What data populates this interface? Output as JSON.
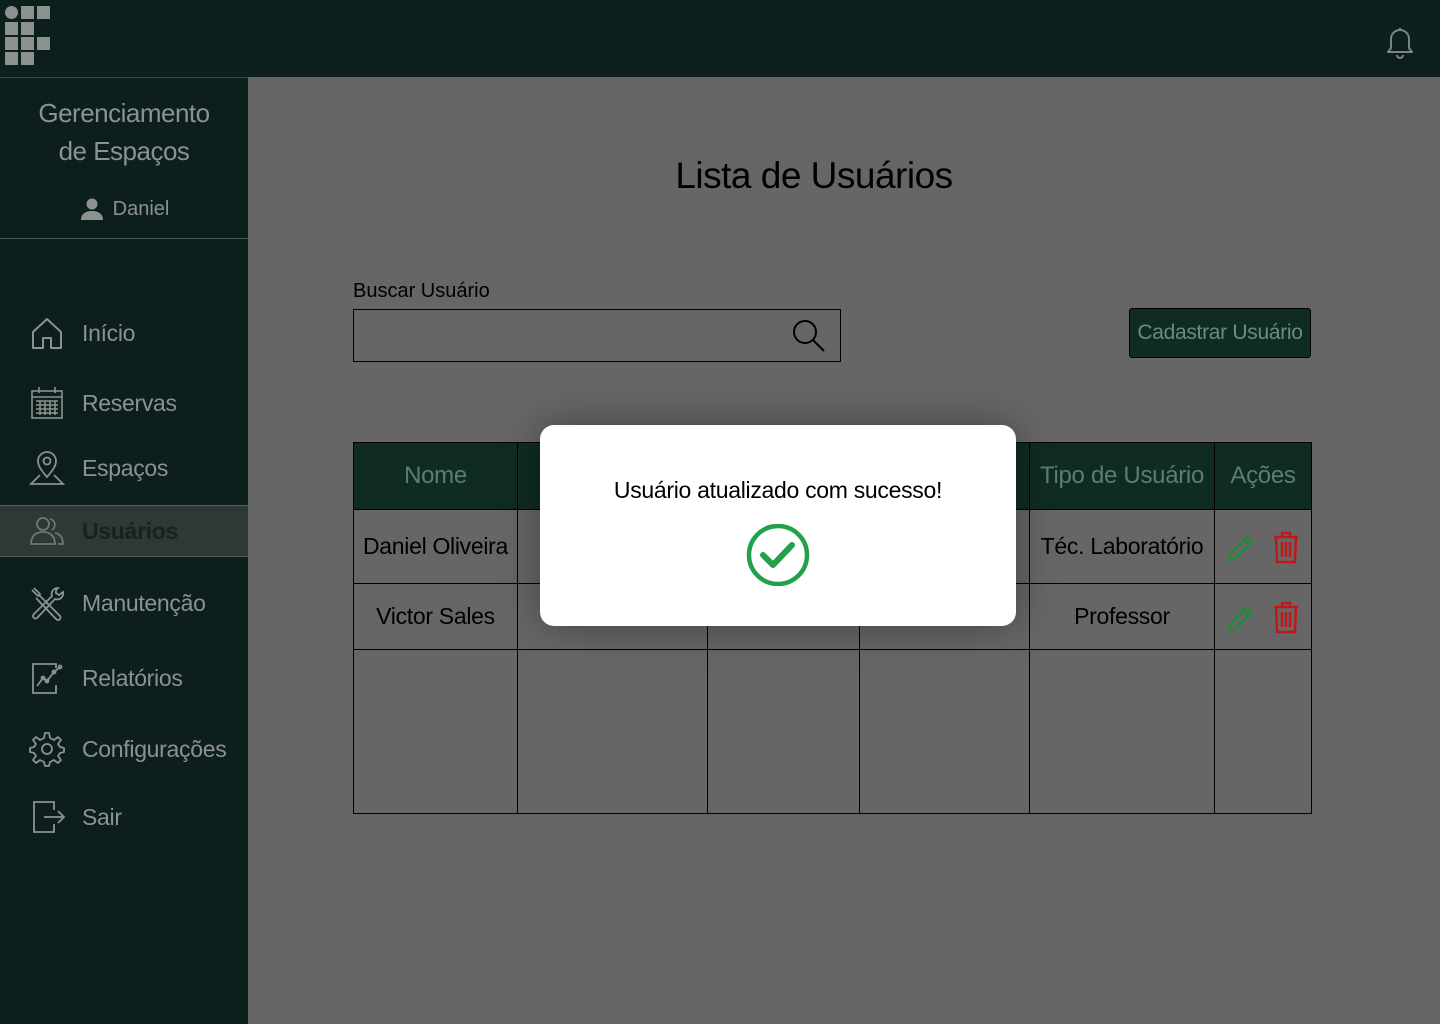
{
  "sidebar": {
    "app_title_line1": "Gerenciamento",
    "app_title_line2": "de Espaços",
    "user_name": "Daniel",
    "items": [
      {
        "label": "Início",
        "icon": "home-icon"
      },
      {
        "label": "Reservas",
        "icon": "calendar-icon"
      },
      {
        "label": "Espaços",
        "icon": "location-pin-icon"
      },
      {
        "label": "Usuários",
        "icon": "users-icon",
        "active": true
      },
      {
        "label": "Manutenção",
        "icon": "tools-icon"
      },
      {
        "label": "Relatórios",
        "icon": "report-chart-icon"
      },
      {
        "label": "Configurações",
        "icon": "gear-icon"
      },
      {
        "label": "Sair",
        "icon": "logout-icon"
      }
    ]
  },
  "header": {
    "notification_icon": "bell-icon"
  },
  "main": {
    "title": "Lista de Usuários",
    "search": {
      "label": "Buscar Usuário",
      "value": "",
      "placeholder": ""
    },
    "add_button": "Cadastrar Usuário",
    "table": {
      "columns": [
        "Nome",
        "",
        "",
        "",
        "Tipo de Usuário",
        "Ações"
      ],
      "rows": [
        {
          "name": "Daniel Oliveira",
          "type": "Téc. Laboratório"
        },
        {
          "name": "Victor Sales",
          "type": "Professor"
        }
      ]
    }
  },
  "modal": {
    "message": "Usuário atualizado com sucesso!",
    "icon": "check-circle-icon"
  },
  "colors": {
    "sidebar_bg": "#0d1f1d",
    "header_cell_bg": "#102b24",
    "overlay_bg": "#666666",
    "edit_green": "#1e8a3a",
    "delete_red": "#c01818",
    "success_green": "#22a04a"
  }
}
